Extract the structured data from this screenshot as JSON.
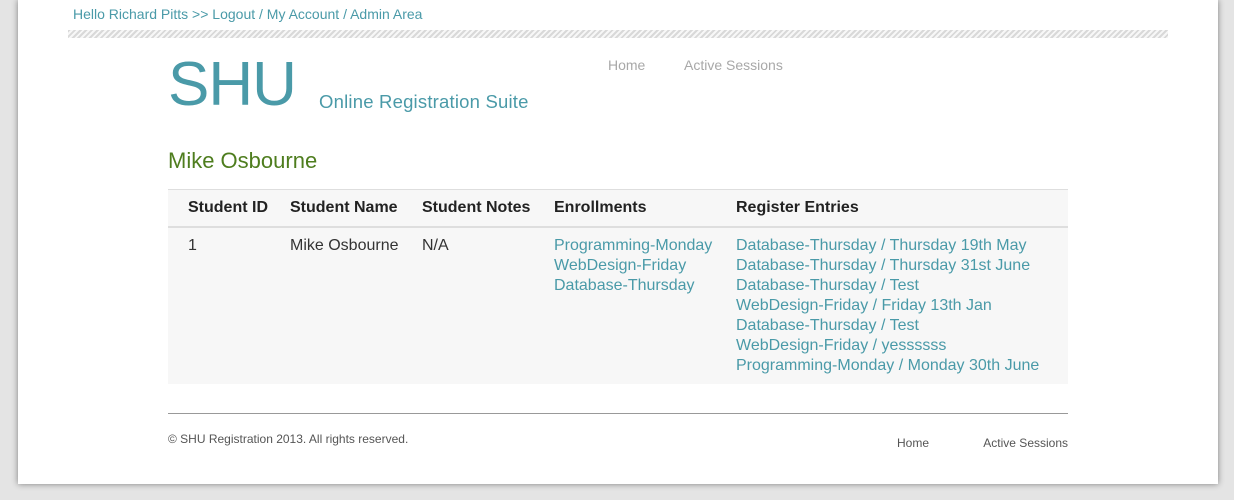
{
  "top_bar": {
    "greeting": "Hello Richard Pitts >>",
    "links": [
      "Logout",
      "My Account",
      "Admin Area"
    ],
    "separator": "/"
  },
  "logo": {
    "big": "SHU",
    "small": "Online Registration Suite"
  },
  "main_nav": [
    "Home",
    "Active Sessions"
  ],
  "student_heading": "Mike Osbourne",
  "table": {
    "headers": [
      "Student ID",
      "Student Name",
      "Student Notes",
      "Enrollments",
      "Register Entries"
    ],
    "row": {
      "id": "1",
      "name": "Mike Osbourne",
      "notes": "N/A",
      "enrollments": [
        "Programming-Monday",
        "WebDesign-Friday",
        "Database-Thursday"
      ],
      "register_entries": [
        "Database-Thursday / Thursday 19th May",
        "Database-Thursday / Thursday 31st June",
        "Database-Thursday / Test",
        "WebDesign-Friday / Friday 13th Jan",
        "Database-Thursday / Test",
        "WebDesign-Friday / yessssss",
        "Programming-Monday / Monday 30th June"
      ]
    }
  },
  "footer": {
    "copyright": "© SHU Registration 2013. All rights reserved.",
    "nav": [
      "Home",
      "Active Sessions"
    ]
  },
  "colors": {
    "accent": "#4a9aa8",
    "heading_green": "#4e7d1e",
    "nav_gray": "#a8a8a8",
    "table_bg": "#f7f7f7"
  }
}
